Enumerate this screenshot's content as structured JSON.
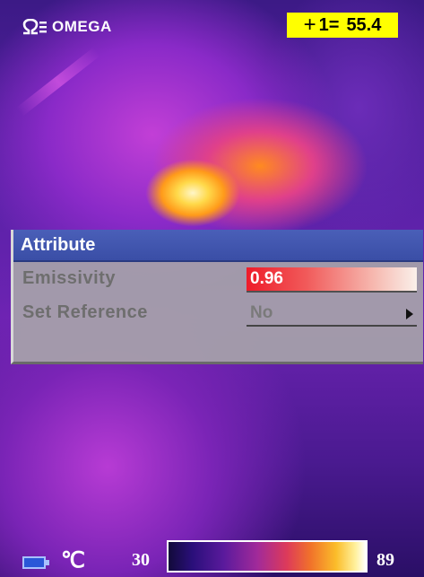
{
  "brand": {
    "name": "OMEGA",
    "logo_icon": "omega-logo-icon"
  },
  "readout": {
    "label": "1=",
    "value": "55.4",
    "bg_color": "#ffff00",
    "icon": "crosshair-icon"
  },
  "dialog": {
    "title": "Attribute",
    "header_color": "#3a4ea6",
    "rows": [
      {
        "label": "Emissivity",
        "value": "0.96"
      },
      {
        "label": "Set Reference",
        "value": "No",
        "icon": "arrow-right-icon"
      }
    ]
  },
  "status_bar": {
    "battery_icon": "battery-icon",
    "unit": "℃",
    "scale_min": "30",
    "scale_max": "89"
  }
}
